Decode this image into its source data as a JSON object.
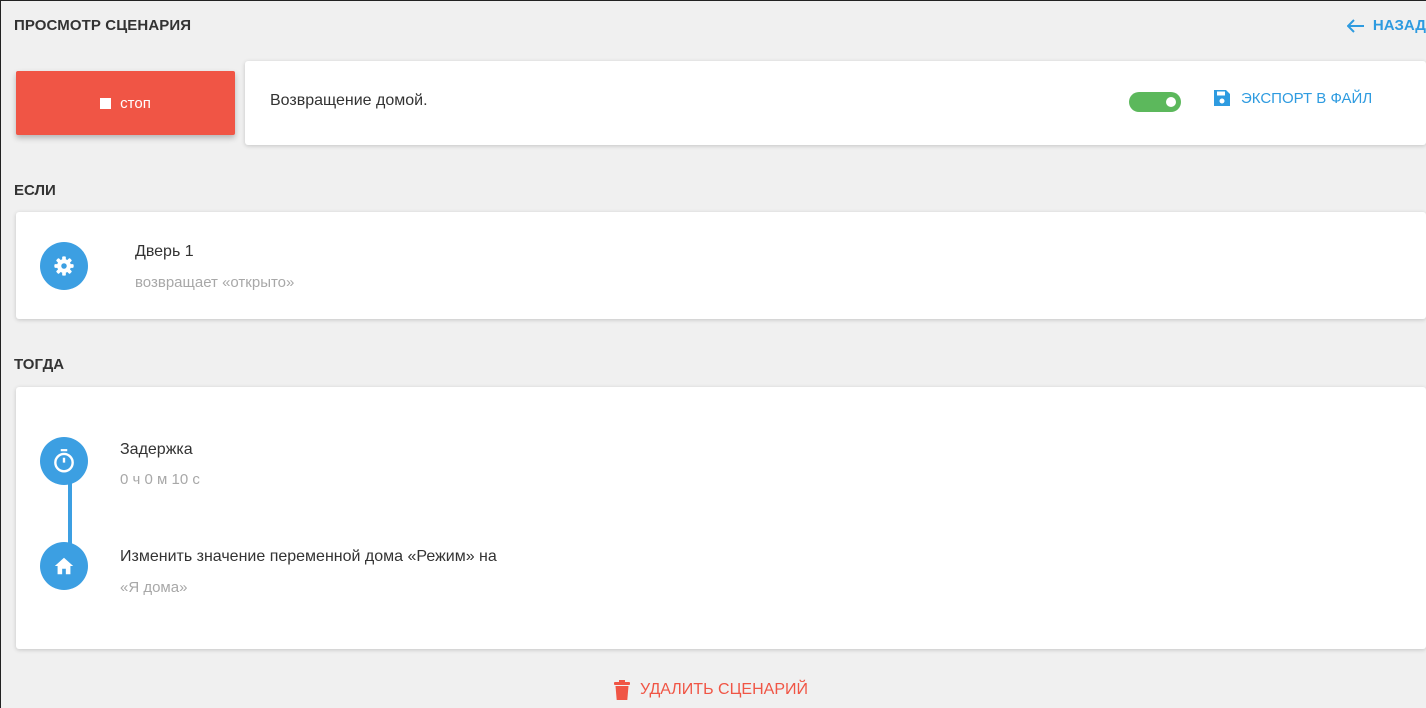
{
  "header": {
    "title": "ПРОСМОТР СЦЕНАРИЯ",
    "back_label": "НАЗАД"
  },
  "controls": {
    "stop_label": "стоп",
    "scenario_name": "Возвращение домой.",
    "enabled": true,
    "export_label": "ЭКСПОРТ В ФАЙЛ"
  },
  "if_section": {
    "label": "ЕСЛИ",
    "conditions": [
      {
        "icon": "gear-icon",
        "title": "Дверь 1",
        "subtitle": "возвращает «открыто»"
      }
    ]
  },
  "then_section": {
    "label": "ТОГДА",
    "actions": [
      {
        "icon": "timer-icon",
        "title": "Задержка",
        "subtitle": "0 ч 0 м 10 с"
      },
      {
        "icon": "home-icon",
        "title": "Изменить значение переменной дома «Режим» на",
        "subtitle": "«Я дома»"
      }
    ]
  },
  "footer": {
    "delete_label": "УДАЛИТЬ СЦЕНАРИЙ"
  },
  "colors": {
    "accent": "#2e9be0",
    "icon_circle": "#3c9fe2",
    "danger": "#f05545",
    "toggle_on": "#5cb85c",
    "background": "#f0f0f0"
  }
}
